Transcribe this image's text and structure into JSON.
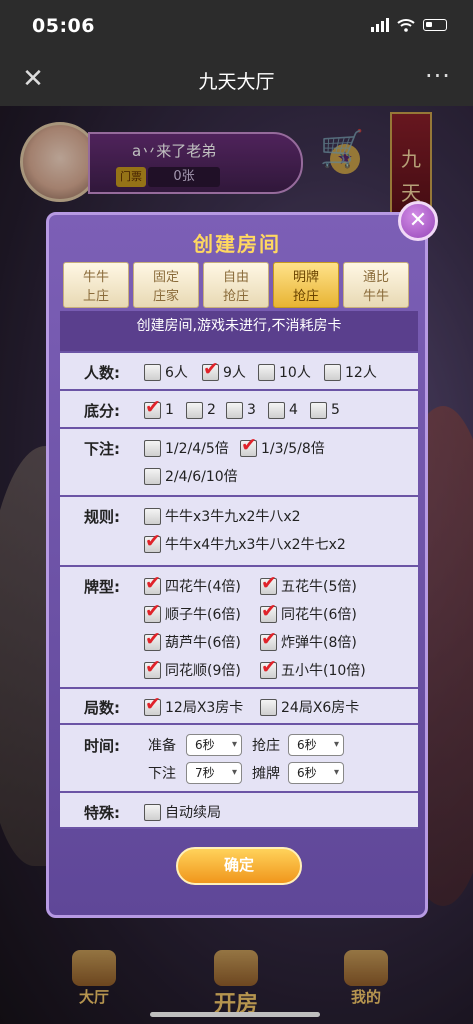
{
  "status": {
    "time": "05:06"
  },
  "nav": {
    "title": "九天大厅",
    "close": "✕",
    "more": "···"
  },
  "profile": {
    "user_name": "a丷来了老弟",
    "card_label": "门票",
    "card_count": "0张"
  },
  "sign": {
    "text": "九天"
  },
  "bottom_nav": {
    "lobby": "大厅",
    "open_room": "开房",
    "mine": "我的"
  },
  "modal": {
    "title": "创建房间",
    "close": "✕",
    "tabs": [
      {
        "line1": "牛牛",
        "line2": "上庄",
        "active": false
      },
      {
        "line1": "固定",
        "line2": "庄家",
        "active": false
      },
      {
        "line1": "自由",
        "line2": "抢庄",
        "active": false
      },
      {
        "line1": "明牌",
        "line2": "抢庄",
        "active": true
      },
      {
        "line1": "通比",
        "line2": "牛牛",
        "active": false
      }
    ],
    "notice": "创建房间,游戏未进行,不消耗房卡",
    "players": {
      "label": "人数:",
      "options": [
        "6人",
        "9人",
        "10人",
        "12人"
      ],
      "checked": [
        false,
        true,
        false,
        false
      ]
    },
    "base": {
      "label": "底分:",
      "options": [
        "1",
        "2",
        "3",
        "4",
        "5"
      ],
      "checked": [
        true,
        false,
        false,
        false,
        false
      ]
    },
    "bet": {
      "label": "下注:",
      "options": [
        "1/2/4/5倍",
        "1/3/5/8倍",
        "2/4/6/10倍"
      ],
      "checked": [
        false,
        true,
        false
      ]
    },
    "rules": {
      "label": "规则:",
      "options": [
        "牛牛x3牛九x2牛八x2",
        "牛牛x4牛九x3牛八x2牛七x2"
      ],
      "checked": [
        false,
        true
      ]
    },
    "card_types": {
      "label": "牌型:",
      "options": [
        "四花牛(4倍)",
        "五花牛(5倍)",
        "顺子牛(6倍)",
        "同花牛(6倍)",
        "葫芦牛(6倍)",
        "炸弹牛(8倍)",
        "同花顺(9倍)",
        "五小牛(10倍)"
      ],
      "checked": [
        true,
        true,
        true,
        true,
        true,
        true,
        true,
        true
      ]
    },
    "rounds": {
      "label": "局数:",
      "options": [
        "12局X3房卡",
        "24局X6房卡"
      ],
      "checked": [
        true,
        false
      ]
    },
    "time": {
      "label": "时间:",
      "prepare_label": "准备",
      "prepare_value": "6秒",
      "grab_label": "抢庄",
      "grab_value": "6秒",
      "bet_label": "下注",
      "bet_value": "7秒",
      "show_label": "摊牌",
      "show_value": "6秒"
    },
    "special": {
      "label": "特殊:",
      "options": [
        "自动续局"
      ],
      "checked": [
        false
      ]
    },
    "confirm": "确定"
  }
}
